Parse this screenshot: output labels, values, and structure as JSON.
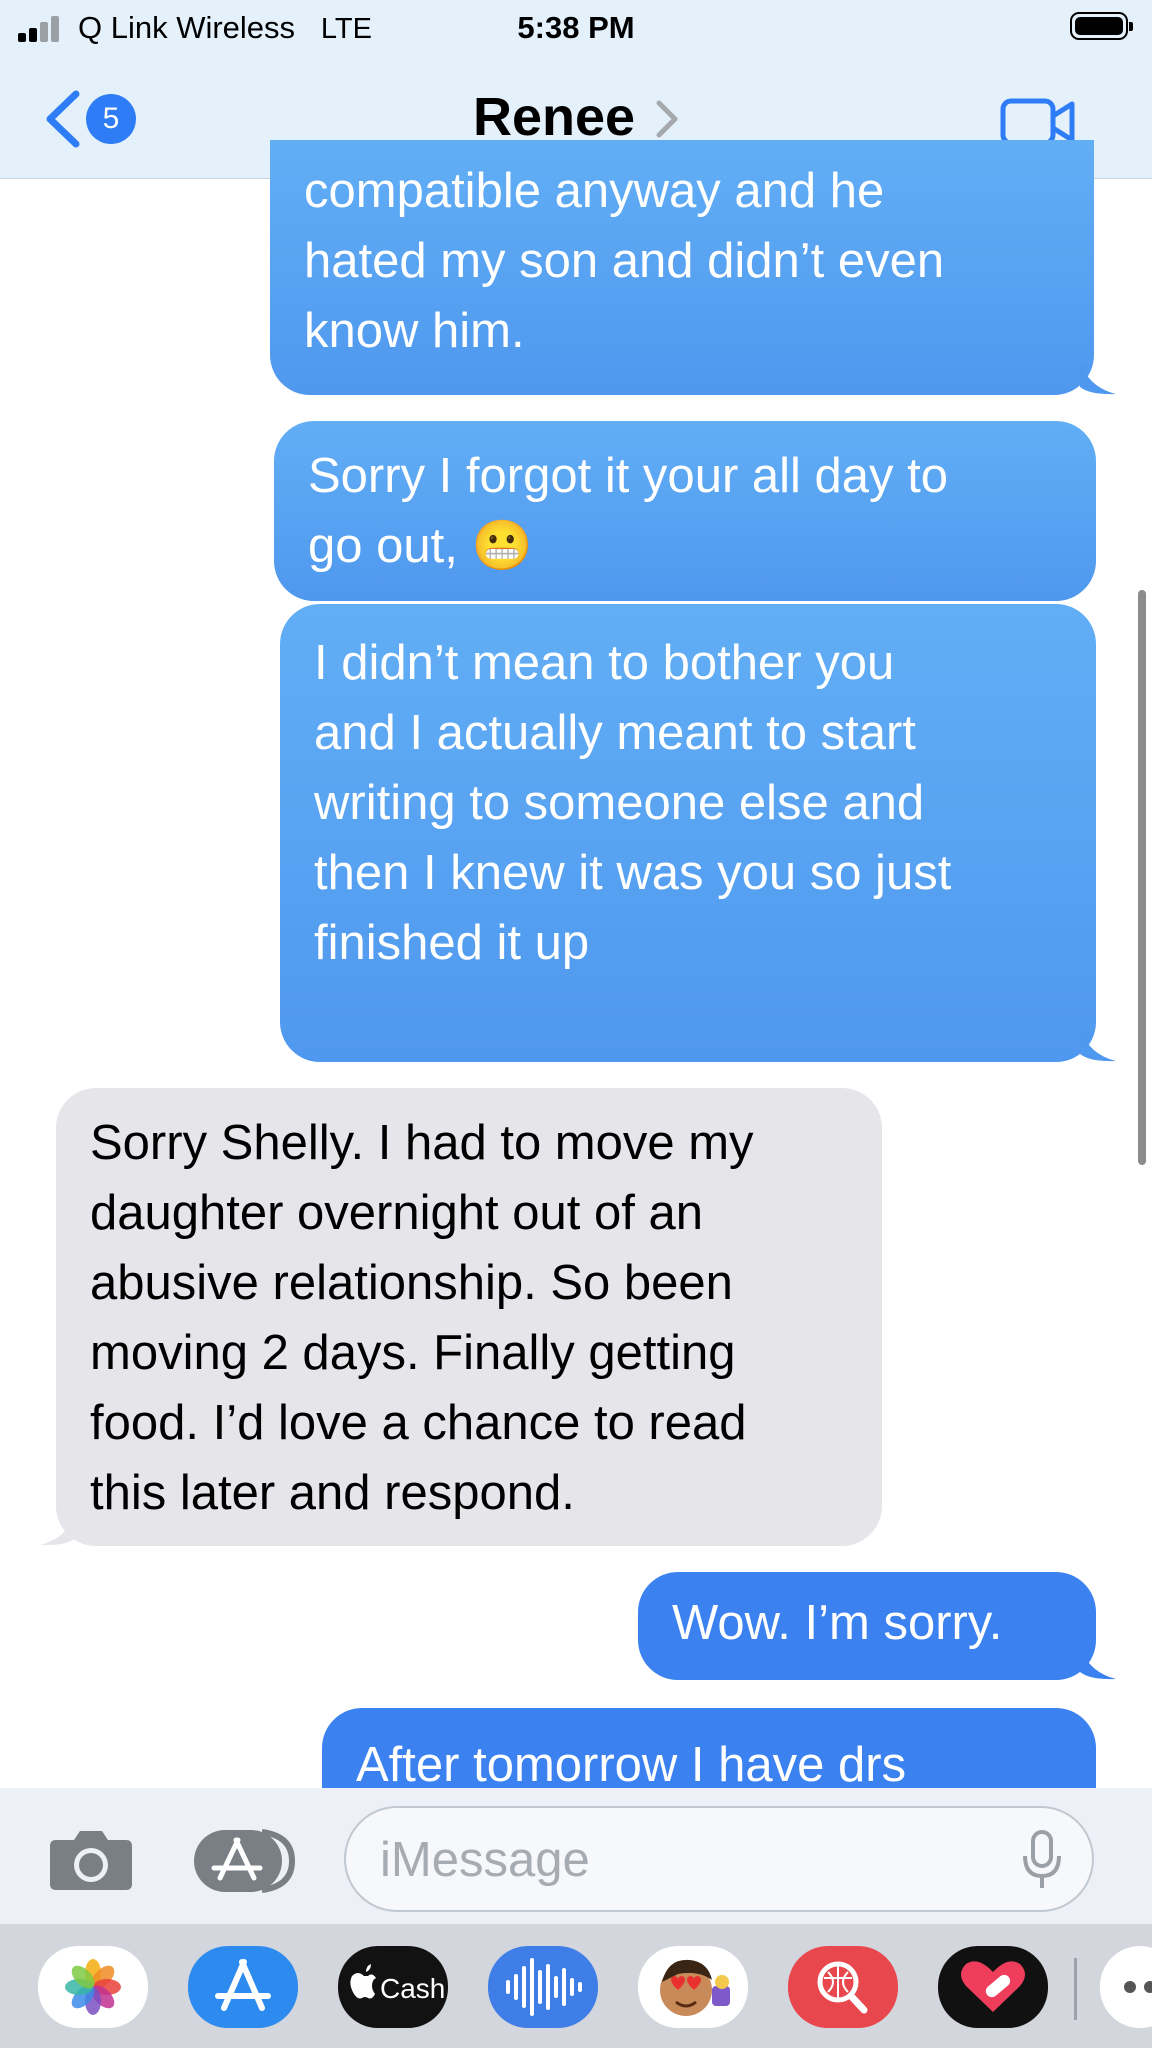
{
  "status_bar": {
    "carrier": "Q Link Wireless",
    "network": "LTE",
    "time": "5:38 PM"
  },
  "header": {
    "back_badge": "5",
    "contact_name": "Renee",
    "back_icon": "chevron-left-icon",
    "video_icon": "video-camera-icon"
  },
  "messages": [
    {
      "direction": "sent",
      "lines": [
        "compatible anyway and he",
        "hated my son and didn’t even",
        "know him."
      ]
    },
    {
      "direction": "sent",
      "lines": [
        "Sorry I forgot it your all day to",
        "go out, 😬"
      ]
    },
    {
      "direction": "sent",
      "lines": [
        "I didn’t mean to bother you",
        "and I actually meant to start",
        "writing to someone else and",
        "then I knew it was you so just",
        "finished it up"
      ]
    },
    {
      "direction": "received",
      "lines": [
        "Sorry Shelly. I had to move my",
        "daughter overnight out of an",
        "abusive relationship. So been",
        "moving 2 days. Finally getting",
        "food. I’d love a chance to read",
        "this later and respond."
      ]
    },
    {
      "direction": "sent",
      "lines": [
        "Wow. I’m sorry."
      ]
    },
    {
      "direction": "sent",
      "lines": [
        "After tomorrow I have drs"
      ]
    }
  ],
  "input": {
    "placeholder": "iMessage",
    "camera_icon": "camera-icon",
    "apps_icon": "app-store-icon",
    "mic_icon": "microphone-icon"
  },
  "app_strip": [
    {
      "name": "photos-app-icon",
      "label": ""
    },
    {
      "name": "app-store-app-icon",
      "label": ""
    },
    {
      "name": "apple-cash-app-icon",
      "label": "Cash"
    },
    {
      "name": "audio-message-app-icon",
      "label": ""
    },
    {
      "name": "memoji-app-icon",
      "label": ""
    },
    {
      "name": "image-search-app-icon",
      "label": ""
    },
    {
      "name": "digital-touch-app-icon",
      "label": ""
    },
    {
      "name": "more-apps-icon",
      "label": ""
    }
  ],
  "colors": {
    "sent_bubble": "#3b82f0",
    "received_bubble": "#e5e5ea",
    "accent": "#2e7cf6",
    "header_bg": "#e4f1fa"
  }
}
